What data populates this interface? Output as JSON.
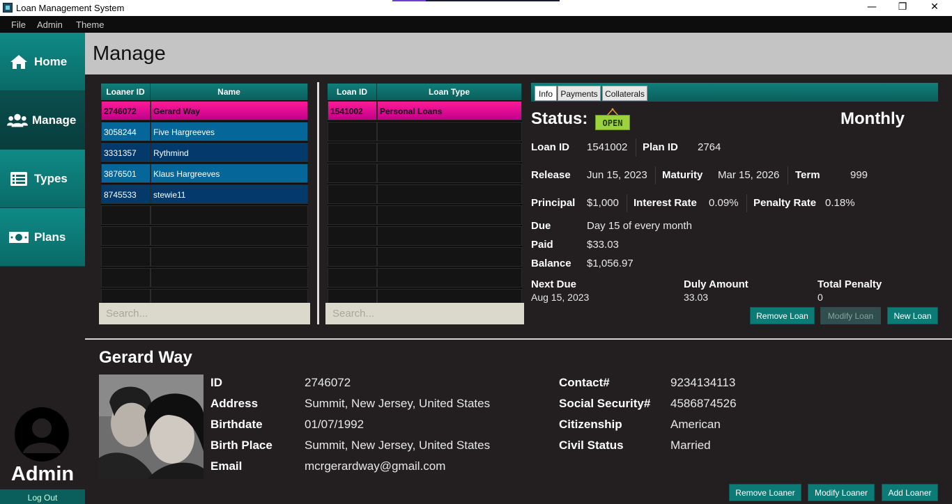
{
  "window": {
    "title": "Loan Management System",
    "minimize": "—",
    "restore": "❐",
    "close": "✕"
  },
  "menu": [
    "File",
    "Admin",
    "Theme"
  ],
  "sidebar": {
    "items": [
      {
        "label": "Home",
        "icon": "home-icon"
      },
      {
        "label": "Manage",
        "icon": "users-icon"
      },
      {
        "label": "Types",
        "icon": "list-icon"
      },
      {
        "label": "Plans",
        "icon": "money-icon"
      }
    ],
    "active": "Manage",
    "user_label": "Admin",
    "logout_label": "Log Out"
  },
  "header": {
    "title": "Manage"
  },
  "loaners_table": {
    "columns": [
      "Loaner ID",
      "Name"
    ],
    "rows": [
      [
        "2746072",
        "Gerard Way"
      ],
      [
        "3058244",
        "Five Hargreeves"
      ],
      [
        "3331357",
        "Rythmind"
      ],
      [
        "3876501",
        "Klaus Hargreeves"
      ],
      [
        "8745533",
        "stewie11"
      ]
    ],
    "selected_row": 0,
    "search_placeholder": "Search..."
  },
  "loans_table": {
    "columns": [
      "Loan ID",
      "Loan Type"
    ],
    "rows": [
      [
        "1541002",
        "Personal Loans"
      ]
    ],
    "selected_row": 0,
    "search_placeholder": "Search..."
  },
  "info_panel": {
    "tabs": [
      "Info",
      "Payments",
      "Collaterals"
    ],
    "active_tab": "Info",
    "status_label": "Status:",
    "status_badge": "OPEN",
    "frequency": "Monthly",
    "loan_id_label": "Loan ID",
    "loan_id": "1541002",
    "plan_id_label": "Plan ID",
    "plan_id": "2764",
    "release_label": "Release",
    "release": "Jun 15, 2023",
    "maturity_label": "Maturity",
    "maturity": "Mar 15, 2026",
    "term_label": "Term",
    "term": "999",
    "principal_label": "Principal",
    "principal": "$1,000",
    "interest_label": "Interest Rate",
    "interest": "0.09%",
    "penalty_label": "Penalty Rate",
    "penalty": "0.18%",
    "due_label": "Due",
    "due": "Day 15 of every month",
    "paid_label": "Paid",
    "paid": "$33.03",
    "balance_label": "Balance",
    "balance": "$1,056.97",
    "next_due_label": "Next Due",
    "next_due": "Aug 15, 2023",
    "duly_label": "Duly Amount",
    "duly": "33.03",
    "total_penalty_label": "Total Penalty",
    "total_penalty": "0",
    "buttons": {
      "remove": "Remove Loan",
      "modify": "Modify Loan",
      "new": "New Loan"
    }
  },
  "loaner_detail": {
    "name": "Gerard Way",
    "id_label": "ID",
    "id": "2746072",
    "address_label": "Address",
    "address": "Summit, New Jersey, United States",
    "birthdate_label": "Birthdate",
    "birthdate": "01/07/1992",
    "birthplace_label": "Birth Place",
    "birthplace": "Summit, New Jersey, United States",
    "email_label": "Email",
    "email": "mcrgerardway@gmail.com",
    "contact_label": "Contact#",
    "contact": "9234134113",
    "ssn_label": "Social Security#",
    "ssn": "4586874526",
    "citizenship_label": "Citizenship",
    "citizenship": "American",
    "civil_label": "Civil Status",
    "civil": "Married",
    "buttons": {
      "remove": "Remove Loaner",
      "modify": "Modify Loaner",
      "add": "Add Loaner"
    }
  },
  "colors": {
    "accent": "#0c7b76",
    "selected_row": "#e0007f",
    "row_alt_a": "#05669a",
    "row_alt_b": "#033a6b",
    "status_badge": "#9bd23d"
  }
}
